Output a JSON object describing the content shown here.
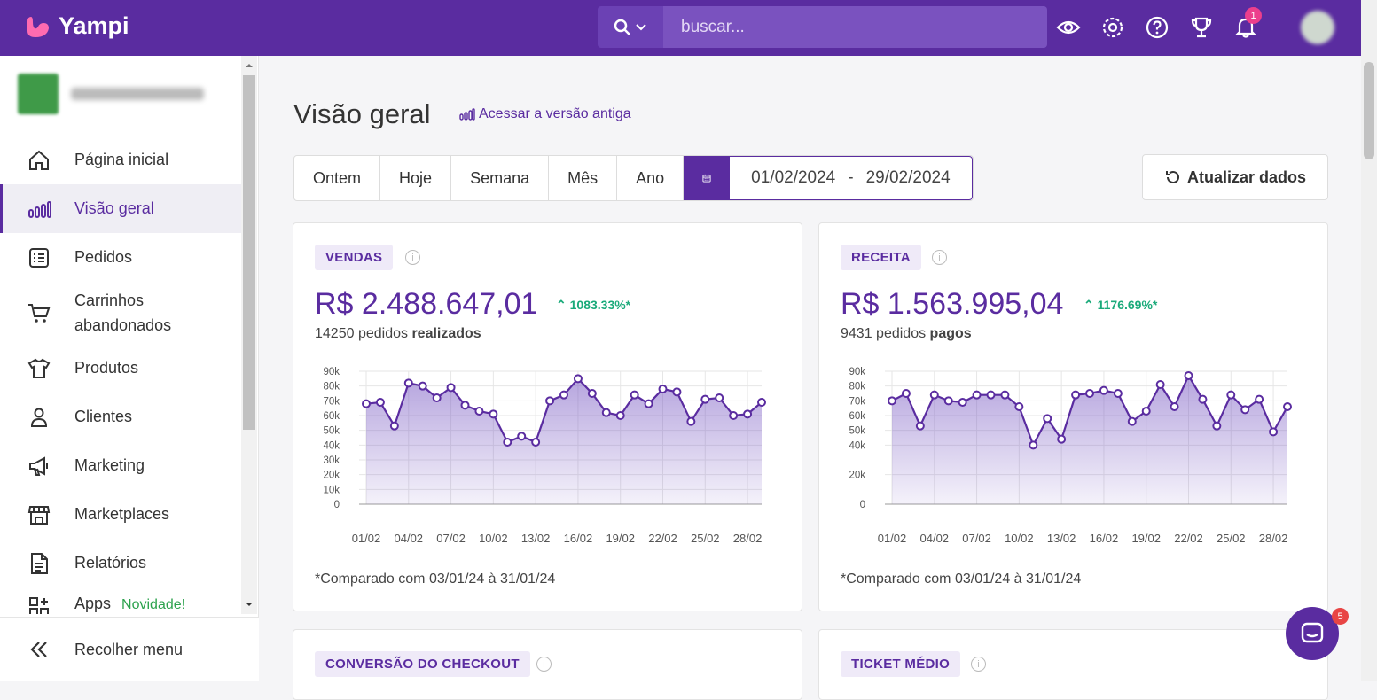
{
  "app": {
    "name": "Yampi"
  },
  "search": {
    "placeholder": "buscar..."
  },
  "topbar": {
    "notifications_count": "1",
    "icons": [
      "eye-icon",
      "gear-icon",
      "help-icon",
      "trophy-icon",
      "bell-icon"
    ]
  },
  "sidebar": {
    "items": [
      {
        "label": "Página inicial",
        "icon": "home-icon"
      },
      {
        "label": "Visão geral",
        "icon": "bars-icon",
        "active": true
      },
      {
        "label": "Pedidos",
        "icon": "list-icon"
      },
      {
        "label": "Carrinhos abandonados",
        "icon": "cart-icon"
      },
      {
        "label": "Produtos",
        "icon": "shirt-icon"
      },
      {
        "label": "Clientes",
        "icon": "user-icon"
      },
      {
        "label": "Marketing",
        "icon": "megaphone-icon"
      },
      {
        "label": "Marketplaces",
        "icon": "store-icon"
      },
      {
        "label": "Relatórios",
        "icon": "report-icon"
      },
      {
        "label": "Apps",
        "icon": "apps-icon",
        "badge": "Novidade!"
      }
    ],
    "collapse_label": "Recolher menu"
  },
  "page": {
    "title": "Visão geral",
    "old_version_link": "Acessar a versão antiga",
    "periods": [
      "Ontem",
      "Hoje",
      "Semana",
      "Mês",
      "Ano"
    ],
    "date_from": "01/02/2024",
    "date_sep": "-",
    "date_to": "29/02/2024",
    "refresh_label": "Atualizar dados"
  },
  "cards": {
    "sales": {
      "tag": "VENDAS",
      "value": "R$ 2.488.647,01",
      "delta": "1083.33%*",
      "sub_count": "14250 pedidos",
      "sub_bold": "realizados",
      "footnote": "*Comparado com 03/01/24 à 31/01/24"
    },
    "revenue": {
      "tag": "RECEITA",
      "value": "R$ 1.563.995,04",
      "delta": "1176.69%*",
      "sub_count": "9431 pedidos",
      "sub_bold": "pagos",
      "footnote": "*Comparado com 03/01/24 à 31/01/24"
    },
    "checkout": {
      "tag": "CONVERSÃO DO CHECKOUT"
    },
    "ticket": {
      "tag": "TICKET MÉDIO"
    }
  },
  "chat": {
    "badge": "5"
  },
  "chart_data": [
    {
      "type": "area",
      "y_ticks": [
        "90k",
        "80k",
        "70k",
        "60k",
        "50k",
        "40k",
        "30k",
        "20k",
        "10k",
        "0"
      ],
      "ylim": [
        0,
        90000
      ],
      "x_ticks": [
        "01/02",
        "04/02",
        "07/02",
        "10/02",
        "13/02",
        "16/02",
        "19/02",
        "22/02",
        "25/02",
        "28/02"
      ],
      "series": [
        {
          "values": [
            68000,
            69000,
            53000,
            82000,
            80000,
            72000,
            79000,
            67000,
            63000,
            61000,
            42000,
            46000,
            42000,
            70000,
            74000,
            85000,
            75000,
            62000,
            60000,
            74000,
            68000,
            78000,
            76000,
            56000,
            71000,
            72000,
            60000,
            61000,
            69000
          ]
        }
      ]
    },
    {
      "type": "area",
      "y_ticks": [
        "90k",
        "80k",
        "70k",
        "60k",
        "50k",
        "40k",
        "20k",
        "0"
      ],
      "ylim": [
        0,
        90000
      ],
      "x_ticks": [
        "01/02",
        "04/02",
        "07/02",
        "10/02",
        "13/02",
        "16/02",
        "19/02",
        "22/02",
        "25/02",
        "28/02"
      ],
      "series": [
        {
          "values": [
            70000,
            75000,
            53000,
            74000,
            70000,
            69000,
            74000,
            74000,
            74000,
            66000,
            40000,
            58000,
            44000,
            74000,
            75000,
            77000,
            75000,
            56000,
            63000,
            81000,
            66000,
            87000,
            71000,
            53000,
            74000,
            64000,
            71000,
            49000,
            66000
          ]
        }
      ]
    }
  ]
}
